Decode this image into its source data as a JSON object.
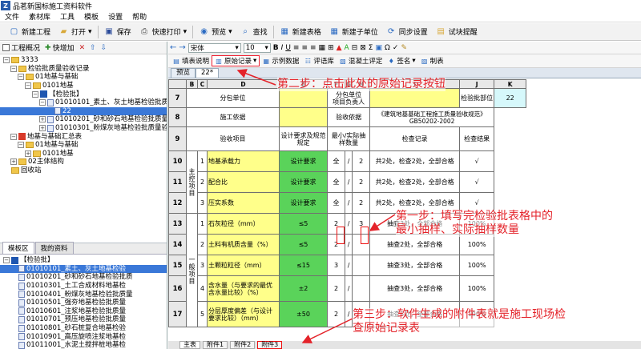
{
  "window": {
    "title": "品茗新国标施工资料软件",
    "icon_label": "Z"
  },
  "menu": [
    "文件",
    "素材库",
    "工具",
    "模板",
    "设置",
    "帮助"
  ],
  "toolbar": [
    {
      "icon": "new-file-icon",
      "label": "新建工程"
    },
    {
      "icon": "open-folder-icon",
      "label": "打开",
      "dropdown": true
    },
    {
      "icon": "save-icon",
      "label": "保存"
    },
    {
      "icon": "print-icon",
      "label": "快速打印",
      "dropdown": true
    },
    {
      "icon": "preview-icon",
      "label": "预览",
      "dropdown": true
    },
    {
      "icon": "search-icon",
      "label": "查找"
    },
    {
      "icon": "new-table-icon",
      "label": "新建表格"
    },
    {
      "icon": "new-subunit-icon",
      "label": "新建子单位"
    },
    {
      "icon": "sync-icon",
      "label": "同步设置"
    },
    {
      "icon": "reminder-icon",
      "label": "试块提醒"
    }
  ],
  "left_panel": {
    "toolbar": [
      "工程概况",
      "快增加"
    ],
    "tree": [
      {
        "level": 0,
        "type": "home",
        "expander": "-",
        "label": "3333"
      },
      {
        "level": 1,
        "type": "folder",
        "expander": "-",
        "label": "检验批质量验收记录"
      },
      {
        "level": 2,
        "type": "folder",
        "expander": "-",
        "label": "01地基与基础"
      },
      {
        "level": 3,
        "type": "folder",
        "expander": "-",
        "label": "0101地基"
      },
      {
        "level": 4,
        "type": "table",
        "expander": "-",
        "label": "【检验批】"
      },
      {
        "level": 5,
        "type": "doc",
        "expander": "-",
        "label": "01010101_素土、灰土地基检验批质"
      },
      {
        "level": 6,
        "type": "doc",
        "expander": "",
        "label": "22",
        "selected": true
      },
      {
        "level": 5,
        "type": "doc",
        "expander": "+",
        "label": "01010201_砂和砂石地基检验批质量"
      },
      {
        "level": 5,
        "type": "doc",
        "expander": "+",
        "label": "01010301_粉煤灰地基检验批质量验"
      },
      {
        "level": 1,
        "type": "history",
        "expander": "-",
        "label": "地基与基础汇总表"
      },
      {
        "level": 2,
        "type": "folder",
        "expander": "-",
        "label": "01地基与基础"
      },
      {
        "level": 3,
        "type": "folder",
        "expander": "+",
        "label": "0101地基"
      },
      {
        "level": 1,
        "type": "folder",
        "expander": "+",
        "label": "02主体结构"
      },
      {
        "level": 0,
        "type": "recycle",
        "expander": "",
        "label": "回收站"
      }
    ],
    "bottom_tabs": [
      "模板区",
      "我的资料"
    ],
    "template_tree": [
      {
        "level": 0,
        "type": "table",
        "expander": "-",
        "label": "【检验批】"
      },
      {
        "level": 1,
        "type": "doc",
        "label": "01010101_素土、灰土地基检验",
        "selected": true
      },
      {
        "level": 1,
        "type": "doc",
        "label": "01010201_砂和砂石地基检验批质"
      },
      {
        "level": 1,
        "type": "doc",
        "label": "01010301_土工合成材料地基检"
      },
      {
        "level": 1,
        "type": "doc",
        "label": "01010401_粉煤灰地基检验批质量"
      },
      {
        "level": 1,
        "type": "doc",
        "label": "01010501_强夯地基检验批质量"
      },
      {
        "level": 1,
        "type": "doc",
        "label": "01010601_注浆地基检验批质量"
      },
      {
        "level": 1,
        "type": "doc",
        "label": "01010701_预压地基检验批质量"
      },
      {
        "level": 1,
        "type": "doc",
        "label": "01010801_砂石桩复合地基检验"
      },
      {
        "level": 1,
        "type": "doc",
        "label": "01010901_高压旋喷注浆地基检"
      },
      {
        "level": 1,
        "type": "doc",
        "label": "01011001_水泥土搅拌桩地基检"
      },
      {
        "level": 1,
        "type": "doc",
        "label": "01011101_土和灰土挤密桩复合"
      }
    ]
  },
  "editor_toolbar": {
    "font_name": "宋体",
    "font_size": "10",
    "buttons": [
      "填表说明",
      "原始记录",
      "示例数据",
      "评语库",
      "混凝土评定",
      "签名",
      "制表"
    ],
    "highlighted": "原始记录"
  },
  "doc_tabs": [
    {
      "label": "预览",
      "active": false
    },
    {
      "label": "22*",
      "active": true
    }
  ],
  "sheet": {
    "col_headers": [
      "B",
      "C",
      "D",
      "E",
      "F",
      "G",
      "H",
      "I",
      "J",
      "K",
      "L"
    ],
    "row7": {
      "row": "7",
      "subcontractor": "分包单位",
      "subcontractor_lead": "分包单位\n项目负责人",
      "lot_part": "检验批部位",
      "lot_part_value": "22"
    },
    "row8": {
      "row": "8",
      "basis": "施工依据",
      "acceptance_basis": "验收依据",
      "basis_value": "《建筑地基基础工程施工质量验收规范》GB50202-2002"
    },
    "row9": {
      "row": "9",
      "item": "验收项目",
      "design": "设计要求及规范规定",
      "sample": "最小/实际抽样数量",
      "record": "检查记录",
      "result": "检查结果"
    },
    "group_main": "主控项目",
    "group_general": "一般项目",
    "rows": [
      {
        "row": "10",
        "no": "1",
        "name": "地基承载力",
        "req": "设计要求",
        "min": "全",
        "act": "2",
        "record": "共2处，检查2处，全部合格",
        "result": "√"
      },
      {
        "row": "11",
        "no": "2",
        "name": "配合比",
        "req": "设计要求",
        "min": "全",
        "act": "2",
        "record": "共2处，检查2处，全部合格",
        "result": "√"
      },
      {
        "row": "12",
        "no": "3",
        "name": "压实系数",
        "req": "设计要求",
        "min": "全",
        "act": "2",
        "record": "共2处，检查2处，全部合格",
        "result": "√"
      },
      {
        "row": "13",
        "no": "1",
        "name": "石灰粒径（mm）",
        "req": "≤5",
        "min": "2",
        "act": "3",
        "record": "抽查3处，全部合格",
        "result": "100%"
      },
      {
        "row": "14",
        "no": "2",
        "name": "土料有机质含量（%）",
        "req": "≤5",
        "min": "2",
        "act": "",
        "record": "抽查2处，全部合格",
        "result": "100%"
      },
      {
        "row": "15",
        "no": "3",
        "name": "土颗粒粒径（mm）",
        "req": "≤15",
        "min": "3",
        "act": "",
        "record": "抽查3处，全部合格",
        "result": "100%"
      },
      {
        "row": "16",
        "no": "4",
        "name": "含水量（与要求的最优含水量比较）（%）",
        "req": "±2",
        "min": "2",
        "act": "",
        "record": "抽查3处，全部合格",
        "result": "100%"
      },
      {
        "row": "17",
        "no": "5",
        "name": "分层厚度偏差（与设计要求比较）（mm）",
        "req": "±50",
        "min": "2",
        "act": "",
        "record": "抽查3处，全部合格",
        "result": "100%"
      }
    ],
    "tabs": [
      "主表",
      "附件1",
      "附件2",
      "附件3"
    ],
    "active_tab": "主表",
    "highlighted_tab": "附件3"
  },
  "annotations": {
    "step2": "第二步：点击此处的原始记录按钮",
    "step1": "第一步：填写完检验批表格中的\n最小抽样、实际抽样数量",
    "step3": "第三步：软件生成的附件表就是施工现场检\n查原始记录表"
  },
  "colors": {
    "annotation": "#e4232a",
    "input_yellow": "#ffff8a",
    "requirement_green": "#5ad35a",
    "value_cyan": "#d6f8fb",
    "tree_selected": "#3a78d8"
  }
}
